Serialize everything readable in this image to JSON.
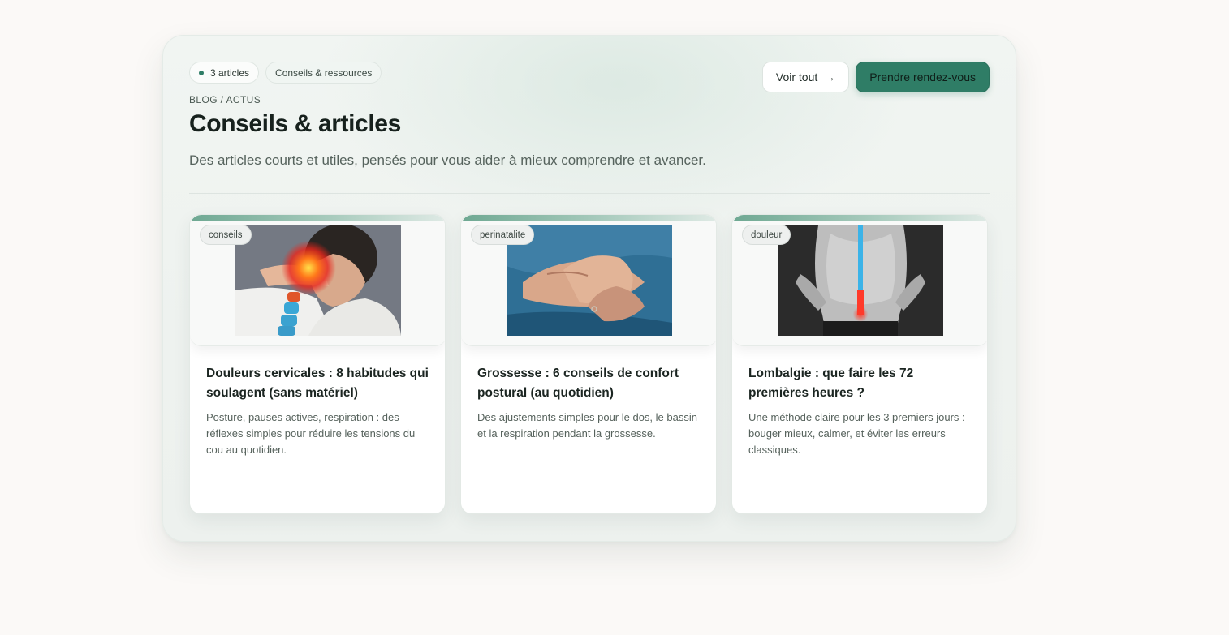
{
  "header": {
    "count_chip": "3 articles",
    "category_chip": "Conseils & ressources",
    "eyebrow": "BLOG / ACTUS",
    "title": "Conseils & articles",
    "subtitle": "Des articles courts et utiles, pensés pour vous aider à mieux comprendre et avancer.",
    "view_all_label": "Voir tout",
    "view_all_arrow": "→",
    "cta_label": "Prendre rendez-vous"
  },
  "articles": [
    {
      "tag": "conseils",
      "image_icon": "neck-pain-photo",
      "title": "Douleurs cervicales : 8 habitudes qui soulagent (sans matériel)",
      "excerpt": "Posture, pauses actives, respiration : des réflexes simples pour réduire les tensions du cou au quotidien."
    },
    {
      "tag": "perinatalite",
      "image_icon": "hands-care-photo",
      "title": "Grossesse : 6 conseils de confort postural (au quotidien)",
      "excerpt": "Des ajustements simples pour le dos, le bassin et la respiration pendant la grossesse."
    },
    {
      "tag": "douleur",
      "image_icon": "lower-back-pain-photo",
      "title": "Lombalgie : que faire les 72 premières heures ?",
      "excerpt": "Une méthode claire pour les 3 premiers jours : bouger mieux, calmer, et éviter les erreurs classiques."
    }
  ],
  "colors": {
    "accent": "#2f7d66",
    "page_bg": "#fbf9f7"
  }
}
